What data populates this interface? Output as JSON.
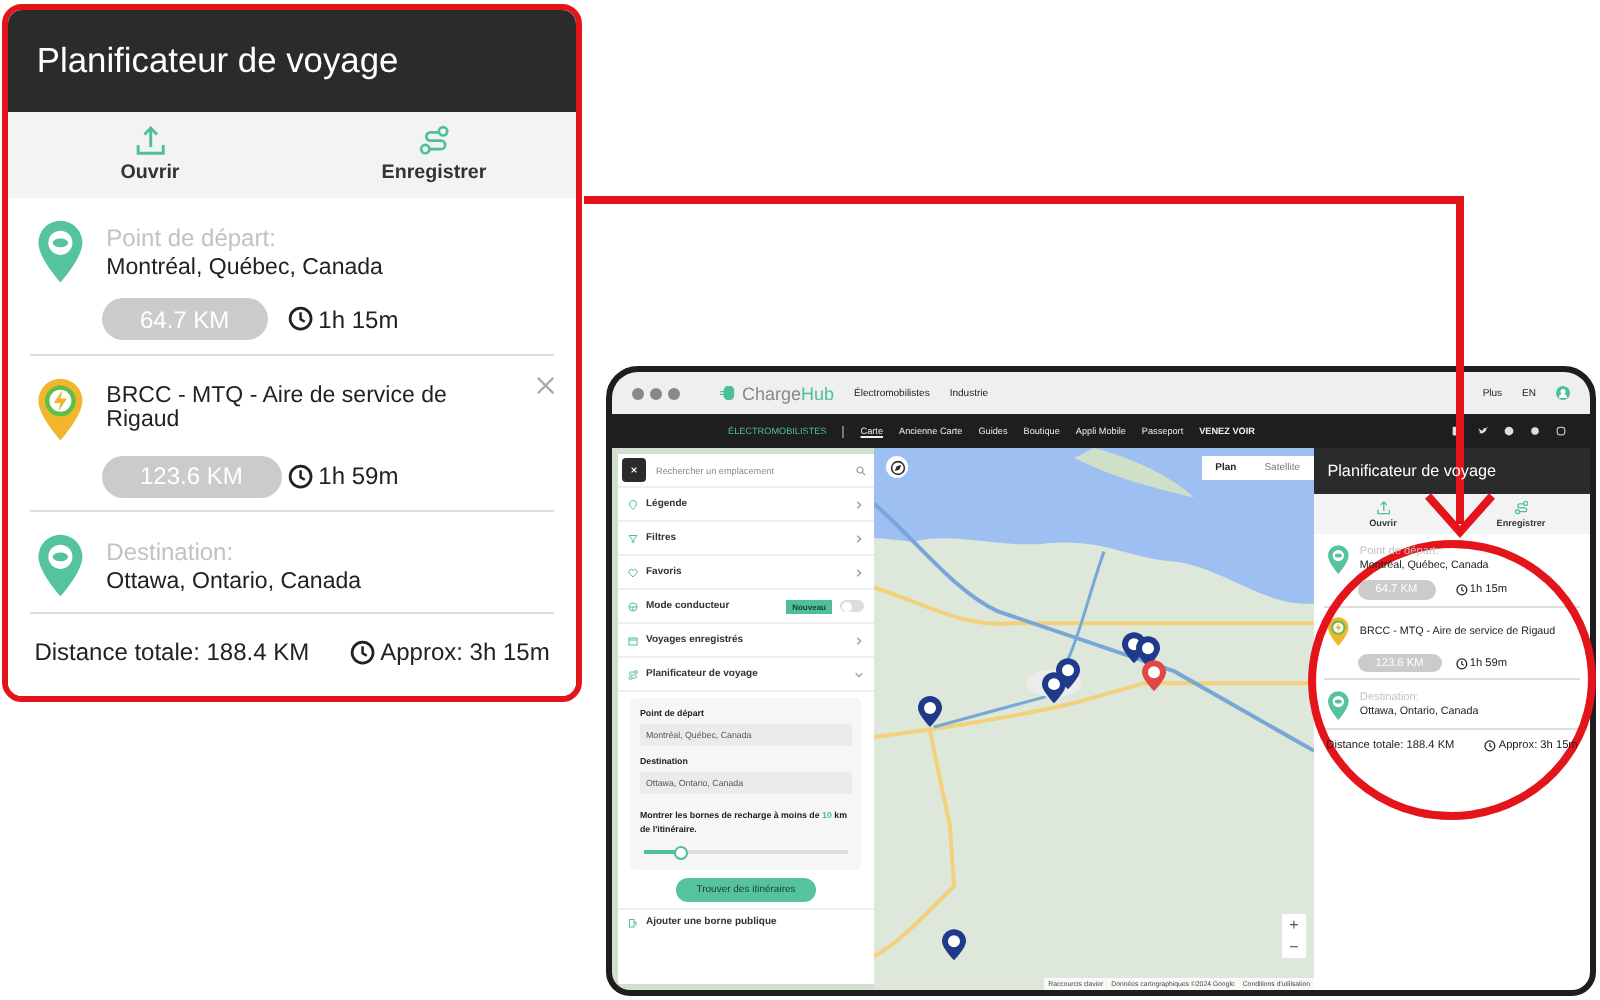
{
  "callout": {
    "title": "Planificateur de voyage",
    "actions": [
      {
        "kind": "open",
        "label": "Ouvrir"
      },
      {
        "kind": "save",
        "label": "Enregistrer"
      }
    ],
    "stops": [
      {
        "kind": "start",
        "label": "Point de départ:",
        "name": "Montréal, Québec, Canada",
        "distance": "64.7 KM",
        "duration": "1h 15m",
        "removable": false
      },
      {
        "kind": "charger",
        "name": "BRCC - MTQ - Aire de service de Rigaud",
        "distance": "123.6 KM",
        "duration": "1h 59m",
        "removable": true
      },
      {
        "kind": "destination",
        "label": "Destination:",
        "name": "Ottawa, Ontario, Canada",
        "removable": false
      }
    ],
    "total": {
      "distance": "Distance totale: 188.4 KM",
      "duration": "Approx: 3h 15m"
    }
  },
  "browser": {
    "logo": {
      "part_1": "Charge",
      "part_2": "Hub"
    },
    "top_links": [
      "Électromobilistes",
      "Industrie"
    ],
    "top_right": [
      "Plus",
      "EN"
    ],
    "nav": {
      "section": "ÉLECTROMOBILISTES",
      "links": [
        {
          "kind": "link",
          "label": "Carte",
          "selected": true
        },
        {
          "kind": "link",
          "label": "Ancienne Carte",
          "selected": false
        },
        {
          "kind": "link",
          "label": "Guides",
          "selected": false
        },
        {
          "kind": "link",
          "label": "Boutique",
          "selected": false
        },
        {
          "kind": "link",
          "label": "Appli Mobile",
          "selected": false
        },
        {
          "kind": "link",
          "label": "Passeport",
          "selected": false
        },
        {
          "kind": "promo",
          "label": "VENEZ VOIR",
          "selected": false
        }
      ]
    },
    "sidebar": {
      "search_placeholder": "Rechercher un emplacement",
      "menu": [
        {
          "kind": "legend",
          "label": "Légende"
        },
        {
          "kind": "filter",
          "label": "Filtres"
        },
        {
          "kind": "favorite",
          "label": "Favoris"
        },
        {
          "kind": "toggle",
          "label": "Mode conducteur",
          "badge": "Nouveau",
          "on": false
        },
        {
          "kind": "saved",
          "label": "Voyages enregistrés"
        },
        {
          "kind": "planner",
          "label": "Planificateur de voyage",
          "expanded": true
        }
      ],
      "planner": {
        "fields": [
          {
            "label": "Point de départ",
            "value": "Montréal, Québec, Canada"
          },
          {
            "label": "Destination",
            "value": "Ottawa, Ontario, Canada"
          }
        ],
        "radius_text": "Montrer les bornes de recharge à moins de **10** km de l'itinéraire.",
        "level": 0.18,
        "button": "Trouver des itinéraires"
      },
      "footer": "Ajouter une borne publique"
    },
    "map": {
      "map_types": [
        {
          "label": "Plan",
          "selected": true
        },
        {
          "label": "Satellite",
          "selected": false
        }
      ],
      "zoom": [
        "+",
        "−"
      ],
      "attribution": [
        "Raccourcis clavier",
        "Données cartographiques ©2024 Google",
        "Conditions d'utilisation"
      ]
    },
    "panel": {
      "title": "Planificateur de voyage",
      "actions": [
        {
          "kind": "open",
          "label": "Ouvrir"
        },
        {
          "kind": "save",
          "label": "Enregistrer"
        }
      ],
      "stops": [
        {
          "kind": "start",
          "label": "Point de départ:",
          "name": "Montréal, Québec, Canada",
          "distance": "64.7 KM",
          "duration": "1h 15m",
          "removable": false
        },
        {
          "kind": "charger",
          "name": "BRCC - MTQ - Aire de service de Rigaud",
          "distance": "123.6 KM",
          "duration": "1h 59m",
          "removable": false
        },
        {
          "kind": "destination",
          "label": "Destination:",
          "name": "Ottawa, Ontario, Canada",
          "removable": false
        }
      ],
      "total": {
        "distance": "Distance totale: 188.4 KM",
        "duration": "Approx: 3h 15m"
      }
    }
  }
}
